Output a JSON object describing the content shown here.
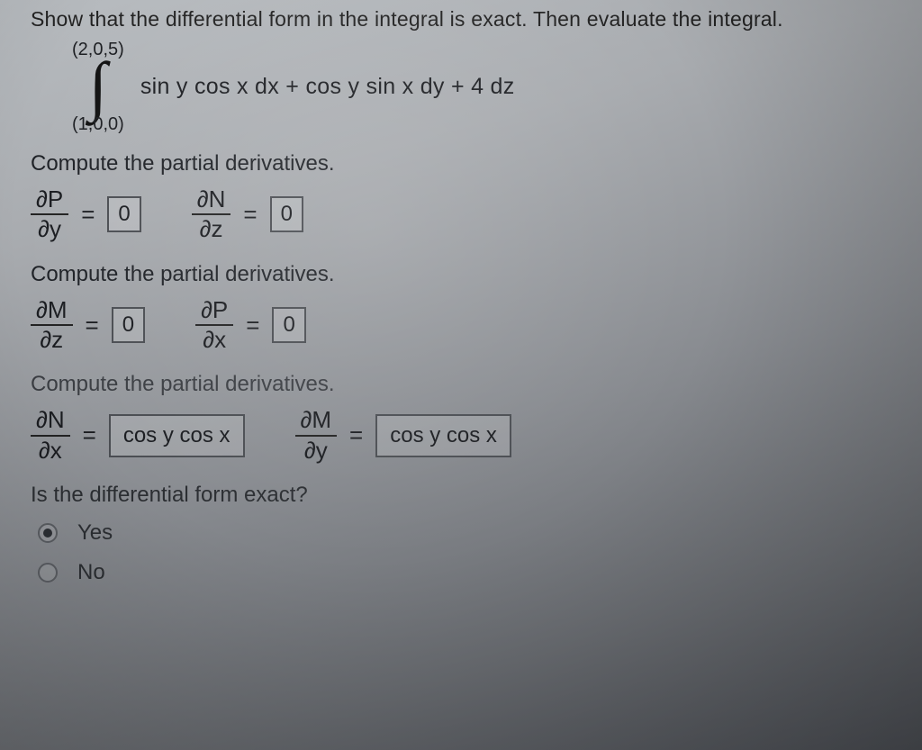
{
  "prompt": "Show that the differential form in the integral is exact. Then evaluate the integral.",
  "integral": {
    "upper": "(2,0,5)",
    "lower": "(1,0,0)",
    "integrand": "sin y cos x dx + cos y sin x dy + 4 dz"
  },
  "section1": {
    "heading": "Compute the partial derivatives.",
    "d1": {
      "num": "∂P",
      "den": "∂y",
      "value": "0"
    },
    "d2": {
      "num": "∂N",
      "den": "∂z",
      "value": "0"
    }
  },
  "section2": {
    "heading": "Compute the partial derivatives.",
    "d1": {
      "num": "∂M",
      "den": "∂z",
      "value": "0"
    },
    "d2": {
      "num": "∂P",
      "den": "∂x",
      "value": "0"
    }
  },
  "section3": {
    "heading": "Compute the partial derivatives.",
    "d1": {
      "num": "∂N",
      "den": "∂x",
      "value": "cos y cos x"
    },
    "d2": {
      "num": "∂M",
      "den": "∂y",
      "value": "cos y cos x"
    }
  },
  "exact_question": "Is the differential form exact?",
  "options": {
    "yes": "Yes",
    "no": "No",
    "selected": "yes"
  }
}
